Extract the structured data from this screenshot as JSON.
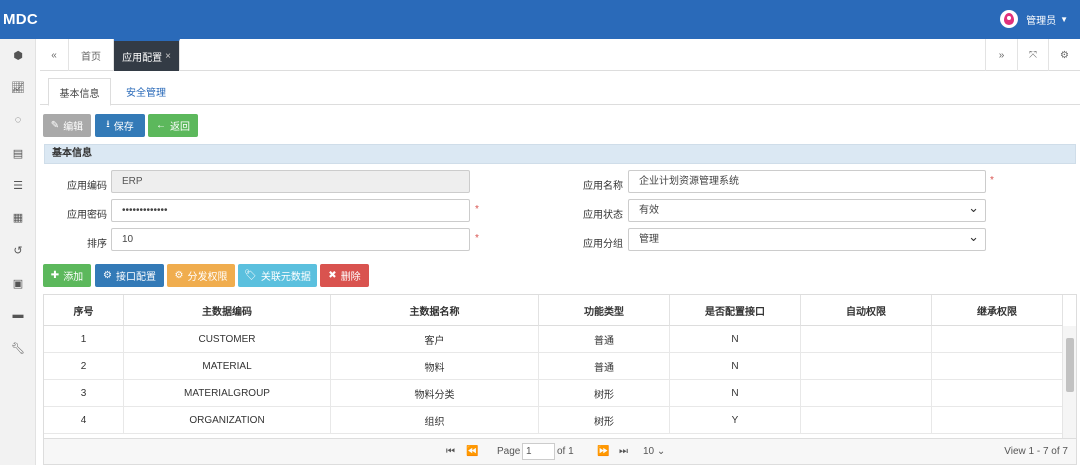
{
  "app": {
    "brand": "MDC",
    "user": "管理员"
  },
  "sidebar": {
    "icons": [
      "dashboard-icon",
      "chart-icon",
      "spinner-icon",
      "database-icon",
      "list-icon",
      "table-icon",
      "history-icon",
      "film-icon",
      "archive-icon",
      "wrench-icon"
    ]
  },
  "tabs": {
    "home": "首页",
    "active": "应用配置",
    "close": "×"
  },
  "subtabs": {
    "basic": "基本信息",
    "security": "安全管理"
  },
  "toolbar": {
    "edit": "编辑",
    "save": "保存",
    "back": "返回"
  },
  "panel": {
    "title": "基本信息"
  },
  "form": {
    "app_code_label": "应用编码",
    "app_code": "ERP",
    "app_name_label": "应用名称",
    "app_name": "企业计划资源管理系统",
    "app_pwd_label": "应用密码",
    "app_pwd": "•••••••••••••",
    "app_status_label": "应用状态",
    "app_status": "有效",
    "sort_label": "排序",
    "sort": "10",
    "app_group_label": "应用分组",
    "app_group": "管理",
    "required": "*"
  },
  "actions": {
    "add": "添加",
    "iface": "接口配置",
    "assign": "分发权限",
    "link": "关联元数据",
    "delete": "删除"
  },
  "grid": {
    "headers": [
      "序号",
      "主数据编码",
      "主数据名称",
      "功能类型",
      "是否配置接口",
      "自动权限",
      "继承权限"
    ],
    "rows": [
      [
        "1",
        "CUSTOMER",
        "客户",
        "普通",
        "N",
        "",
        ""
      ],
      [
        "2",
        "MATERIAL",
        "物料",
        "普通",
        "N",
        "",
        ""
      ],
      [
        "3",
        "MATERIALGROUP",
        "物料分类",
        "树形",
        "N",
        "",
        ""
      ],
      [
        "4",
        "ORGANIZATION",
        "组织",
        "树形",
        "Y",
        "",
        ""
      ]
    ]
  },
  "pager": {
    "page_label": "Page",
    "page": "1",
    "of": "of 1",
    "size": "10",
    "view": "View 1 - 7 of 7"
  },
  "colors": {
    "topbar": "#2a6ab9",
    "save": "#337ab7",
    "back": "#5cb85c",
    "assign": "#f0ad4e",
    "link": "#5bc0de",
    "delete": "#d9534f"
  }
}
